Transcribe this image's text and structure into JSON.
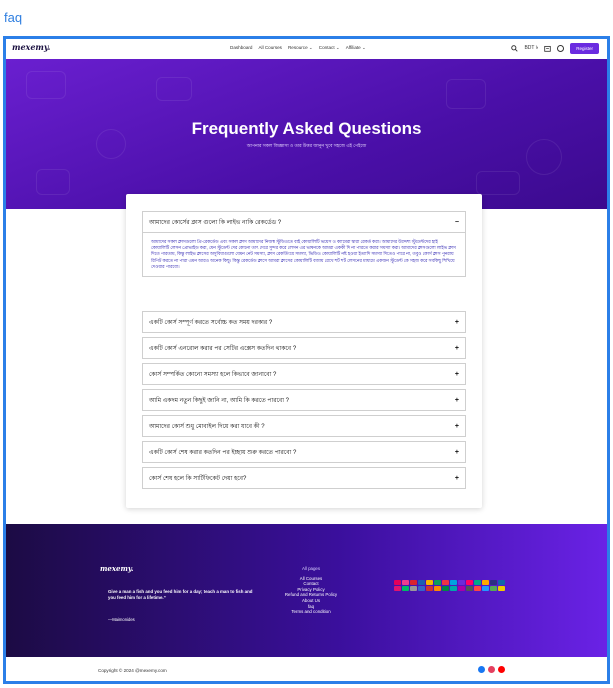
{
  "page_label": "faq",
  "nav": {
    "logo": "mexemy.",
    "menu": [
      "Dashboard",
      "All Courses",
      "Resource ⌄",
      "Contact ⌄",
      "Affiliate ⌄"
    ],
    "currency": "BDT ৳",
    "register": "Register"
  },
  "hero": {
    "title": "Frequently Asked Questions",
    "subtitle": "আপনার সকল জিজ্ঞাসা ও তার উত্তর জানুন খুবে সহজে এই পেইজে"
  },
  "faq": {
    "items": [
      {
        "question": "আমাদের কোর্সের ক্লাস গুলো কি লাইভ নাকি রেকর্ডেড ?",
        "sign": "−",
        "answer": "আমাদের সকল ক্লাসগুলো প্রি-রেকর্ডেড এবং সকল ক্লাস আমাদের নিজস্ব স্টুডিওতে বাই কোয়ালিটি ভয়েস ও ক্যামেরা দ্বারা রেকর্ড করা। আমাদের উদ্দেশ্য স্টুডেন্টদের হাই কোয়ালিটি লেসন প্রোভাইড করা, যেন স্টুডেন্ট দের কোনো তাৎ দেরে সুন্দর করে লেসন এর ভাষনকে আমরা এককী দি না পারতে করার সমস্যা করা। আমাদের ক্লাসগুলো লাইভ ক্লাস দিতে পারতাম, কিন্তু লাইভ ক্লাসের অসুবিধাগুলো যেমন নেট সমস্যা, ক্লাস রেকর্ডিংয়ে সমস্যা, ভিডিও কোয়ালিটি নষ্ট হওয়া ইত্যাদি সমস্যা দিতেও পারে না, তবুও কোর্স ক্লাস পুনরায় রিপিট করতে না পারা এমন আরও অনেক কিছু। কিন্তু রেকর্ডেড ক্লাসে আমরা ক্লাসের কোয়ালিটি বজায় রেখে শর্ট শর্ট লেসনের মাধ্যমে একজন স্টুডেন্ট কে সহজ করে সবকিছু শিখিয়ে দেওয়ার পারবো।"
      },
      {
        "question": "একটি কোর্স সম্পূর্ণ করতে সর্বোচ্চ কত সময় দরকার ?",
        "sign": "+"
      },
      {
        "question": "একটি কোর্স এনরোল করার পর সেটির এক্সেস কতদিন থাকবে ?",
        "sign": "+"
      },
      {
        "question": "কোর্স সম্পর্কিত কোনো সমস্যা হলে কিভাবে জানাবো ?",
        "sign": "+"
      },
      {
        "question": "আমি একদম নতুন কিছুই জানি না, আমি কি করতে পারবো ?",
        "sign": "+"
      },
      {
        "question": "আমাদের কোর্স শুধু মোবাইল দিয়ে করা যাবে কী ?",
        "sign": "+"
      },
      {
        "question": "একটি কোর্স শেষ করার কতদিন পর ইচ্ছায় শুরু করতে পারবো ?",
        "sign": "+"
      },
      {
        "question": "কোর্স শেষ হলে কি সার্টিফিকেট দেয়া হবে?",
        "sign": "+"
      }
    ]
  },
  "footer": {
    "logo": "mexemy.",
    "quote": "Give a man a fish and you feed him for a day; teach a man to fish and you feed him for a lifetime.”",
    "author": "—Maimonides",
    "links_heading": "All pages",
    "links": [
      "All Courses",
      "Contact",
      "Privacy Policy",
      "Refund and Returns Policy",
      "About Us",
      "faq",
      "Terms and condition"
    ],
    "payment_colors": [
      "#e4005a",
      "#ee3d8f",
      "#d9232e",
      "#1a5fb4",
      "#f7b500",
      "#0f9d58",
      "#e34",
      "#00a3e0",
      "#6b2bd9",
      "#f06",
      "#0a8",
      "#fa0",
      "#2d2e83",
      "#16a",
      "#e2136e",
      "#0b6",
      "#999",
      "#36c",
      "#c33",
      "#f80",
      "#084",
      "#0aa",
      "#a0a",
      "#555",
      "#f44",
      "#29f",
      "#5a5",
      "#ec0"
    ],
    "copyright": "Copyright © 2024 @mexemy.com",
    "social_colors": [
      "#1877f2",
      "#e4405f",
      "#ff0000"
    ]
  }
}
